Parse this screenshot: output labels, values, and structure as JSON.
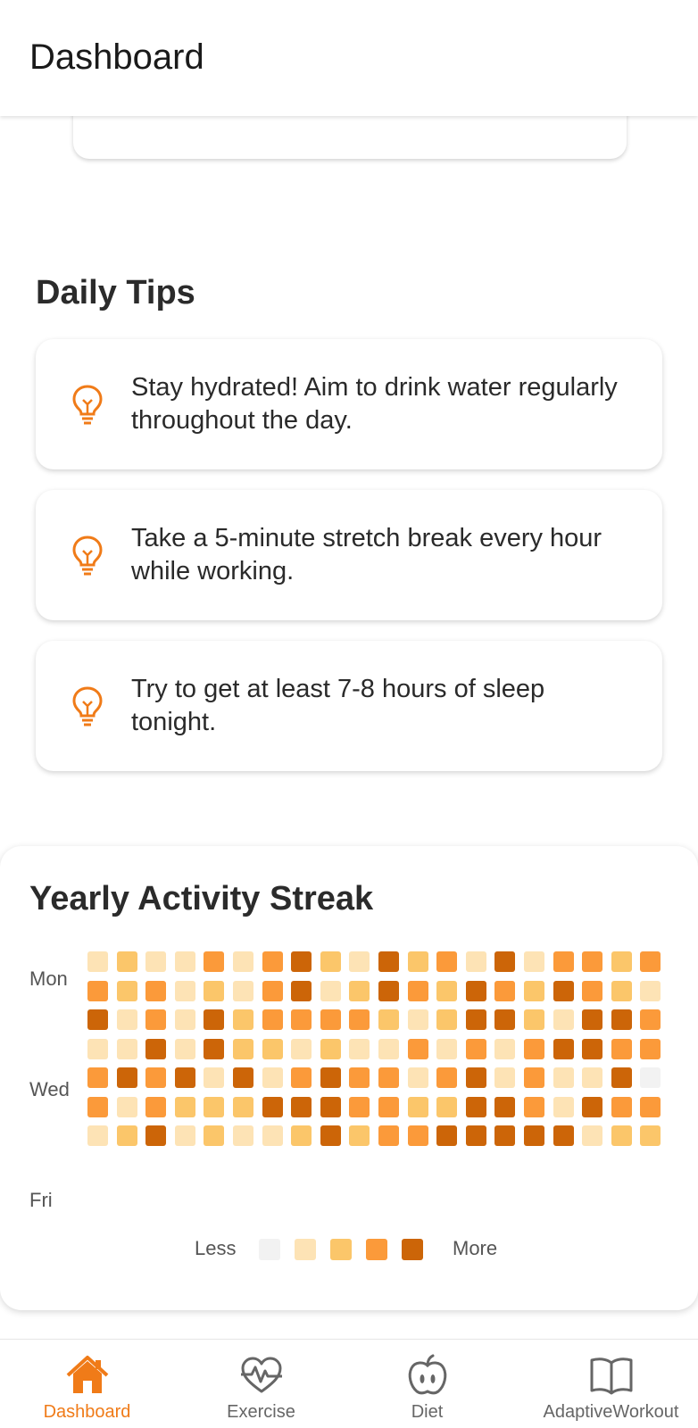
{
  "header": {
    "title": "Dashboard"
  },
  "daily_tips": {
    "title": "Daily Tips",
    "icon": "lightbulb-icon",
    "tips": [
      "Stay hydrated! Aim to drink water regularly throughout the day.",
      "Take a 5-minute stretch break every hour while working.",
      "Try to get at least 7-8 hours of sleep tonight."
    ]
  },
  "activity_streak": {
    "title": "Yearly Activity Streak",
    "day_labels": {
      "mon": "Mon",
      "wed": "Wed",
      "fri": "Fri"
    },
    "legend": {
      "less": "Less",
      "more": "More"
    },
    "level_colors": [
      "#f2f2f2",
      "#fde3b5",
      "#fbc66a",
      "#fb9a3a",
      "#cc6508"
    ],
    "rows": [
      [
        1,
        2,
        1,
        1,
        3,
        1,
        3,
        4,
        2,
        1,
        4,
        2,
        3,
        1,
        4,
        1,
        3,
        3,
        2,
        3
      ],
      [
        3,
        2,
        3,
        1,
        2,
        1,
        3,
        4,
        1,
        2,
        4,
        3,
        2,
        4,
        3,
        2,
        4,
        3,
        2,
        1
      ],
      [
        4,
        1,
        3,
        1,
        4,
        2,
        3,
        3,
        3,
        3,
        2,
        1,
        2,
        4,
        4,
        2,
        1,
        4,
        4,
        3
      ],
      [
        1,
        1,
        4,
        1,
        4,
        2,
        2,
        1,
        2,
        1,
        1,
        3,
        1,
        3,
        1,
        3,
        4,
        4,
        3,
        3
      ],
      [
        3,
        4,
        3,
        4,
        1,
        4,
        1,
        3,
        4,
        3,
        3,
        1,
        3,
        4,
        1,
        3,
        1,
        1,
        4,
        0
      ],
      [
        3,
        1,
        3,
        2,
        2,
        2,
        4,
        4,
        4,
        3,
        3,
        2,
        2,
        4,
        4,
        3,
        1,
        4,
        3,
        3
      ],
      [
        1,
        2,
        4,
        1,
        2,
        1,
        1,
        2,
        4,
        2,
        3,
        3,
        4,
        4,
        4,
        4,
        4,
        1,
        2,
        2
      ]
    ]
  },
  "bottom_nav": {
    "items": [
      {
        "label": "Dashboard",
        "icon": "home-icon",
        "active": true
      },
      {
        "label": "Exercise",
        "icon": "heart-pulse-icon",
        "active": false
      },
      {
        "label": "Diet",
        "icon": "apple-icon",
        "active": false
      },
      {
        "label": "AdaptiveWorkout",
        "icon": "book-icon",
        "active": false
      }
    ],
    "colors": {
      "active": "#f07b18",
      "inactive": "#666666"
    }
  }
}
